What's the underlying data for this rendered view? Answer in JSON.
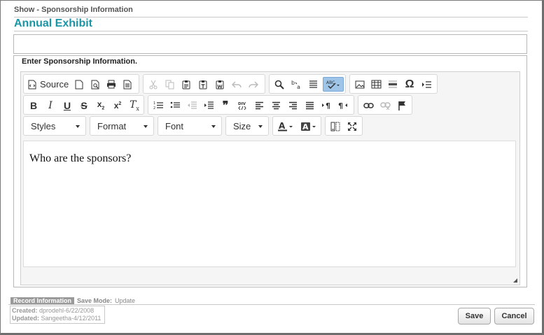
{
  "dialog": {
    "title": "Show - Sponsorship Information",
    "record_title": "Annual Exhibit"
  },
  "section": {
    "label": "Enter Sponsorship Information."
  },
  "toolbar": {
    "source_label": "Source",
    "styles_label": "Styles",
    "format_label": "Format",
    "font_label": "Font",
    "size_label": "Size"
  },
  "editor": {
    "content": "Who are the sponsors?"
  },
  "record_info": {
    "badge": "Record Information",
    "save_mode_label": "Save Mode:",
    "save_mode_value": "Update",
    "created_label": "Created:",
    "created_value": "dprodehl-6/22/2008",
    "updated_label": "Updated:",
    "updated_value": "Sangeetha-4/12/2011"
  },
  "buttons": {
    "save": "Save",
    "cancel": "Cancel"
  }
}
